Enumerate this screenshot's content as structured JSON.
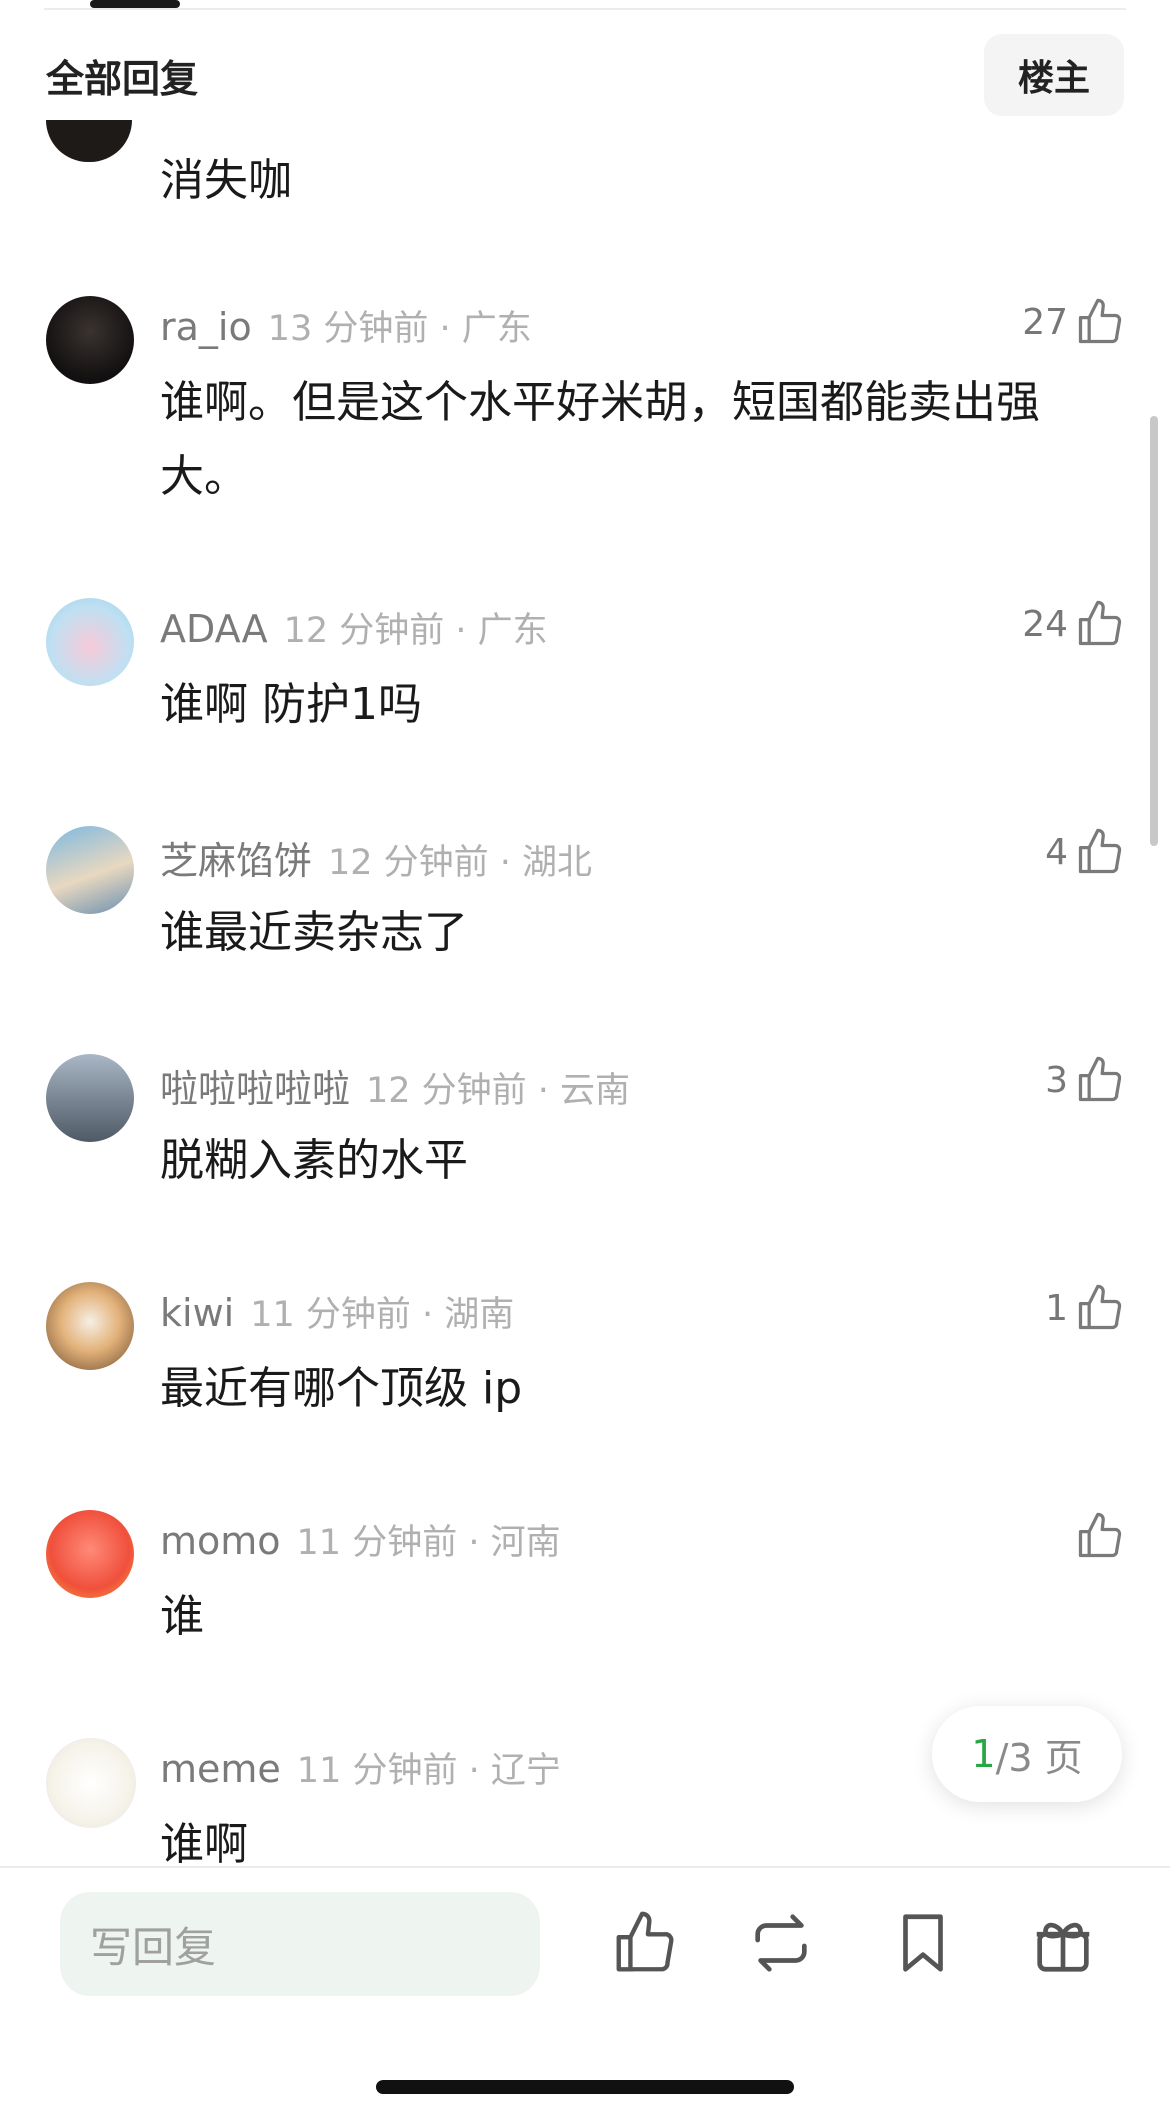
{
  "header": {
    "title": "全部回复",
    "filter_label": "楼主"
  },
  "partial_comment": {
    "text": "消失咖"
  },
  "comments": [
    {
      "user": "ra_io",
      "time": "13 分钟前 · 广东",
      "text": "谁啊。但是这个水平好米胡，短国都能卖出强大。",
      "likes": "27"
    },
    {
      "user": "ADAA",
      "time": "12 分钟前 · 广东",
      "text": "谁啊 防护1吗",
      "likes": "24"
    },
    {
      "user": "芝麻馅饼",
      "time": "12 分钟前 · 湖北",
      "text": "谁最近卖杂志了",
      "likes": "4"
    },
    {
      "user": "啦啦啦啦啦",
      "time": "12 分钟前 · 云南",
      "text": "脱糊入素的水平",
      "likes": "3"
    },
    {
      "user": "kiwi",
      "time": "11 分钟前 · 湖南",
      "text": "最近有哪个顶级 ip",
      "likes": "1"
    },
    {
      "user": "momo",
      "time": "11 分钟前 · 河南",
      "text": "谁",
      "likes": ""
    },
    {
      "user": "meme",
      "time": "11 分钟前 · 辽宁",
      "text": "谁啊",
      "likes": ""
    }
  ],
  "pager": {
    "current": "1",
    "total_label": "/3 页"
  },
  "reply_bar": {
    "placeholder": "写回复"
  },
  "icons": [
    "like-icon",
    "repost-icon",
    "bookmark-icon",
    "gift-icon"
  ],
  "colors": {
    "accent": "#27a845",
    "meta": "#b0b0b0"
  }
}
